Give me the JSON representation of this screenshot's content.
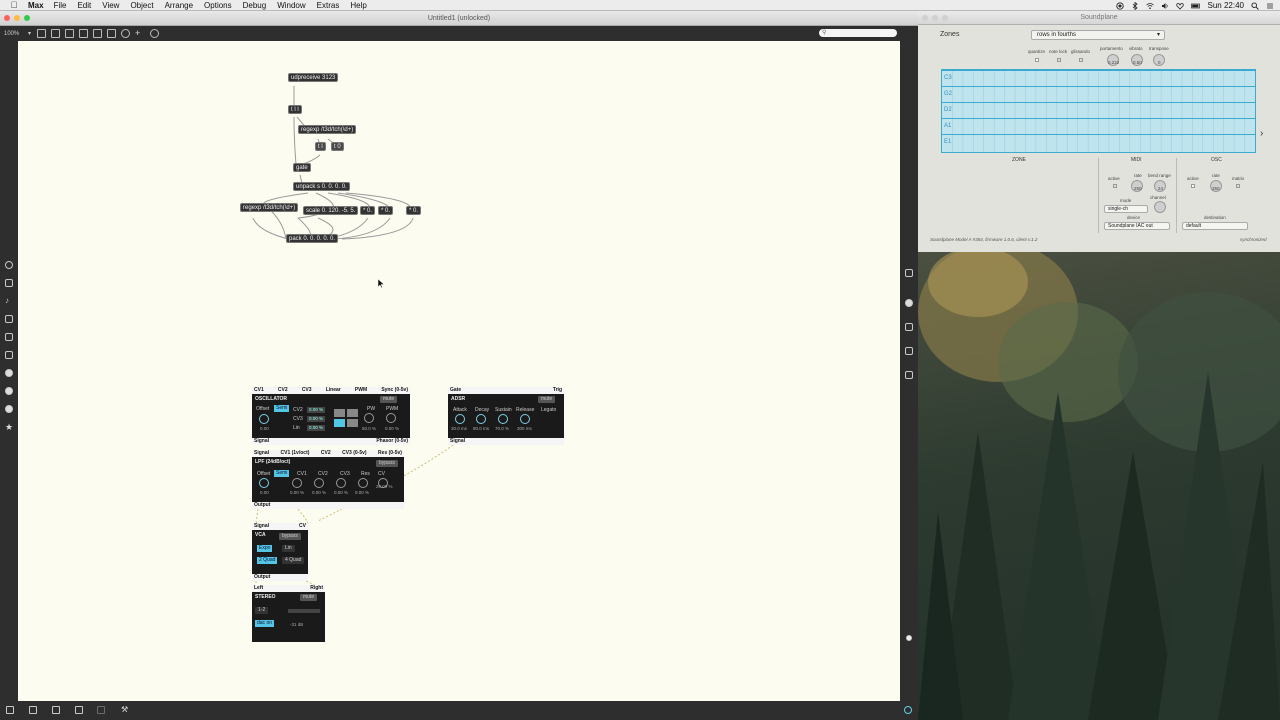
{
  "menubar": {
    "app_name": "Max",
    "items": [
      "File",
      "Edit",
      "View",
      "Object",
      "Arrange",
      "Options",
      "Debug",
      "Window",
      "Extras",
      "Help"
    ],
    "clock": "Sun 22:40"
  },
  "max_window": {
    "title": "Untitled1 (unlocked)",
    "zoom": "100%"
  },
  "patch": {
    "objects": [
      "udpreceive 3123",
      "t l l",
      "regexp /t3d/tch(\\d+)",
      "t l",
      "t 0",
      "gate",
      "unpack s 0. 0. 0. 0.",
      "regexp /t3d/tch(\\d+)",
      "scale 0. 120. -5. 5.",
      "* 0.",
      "* 0.",
      "* 0.",
      "pack 0. 0. 0. 0. 0."
    ]
  },
  "osc_module": {
    "inputs": [
      "CV1",
      "CV2",
      "CV3",
      "Linear",
      "PWM",
      "Sync (0-5v)"
    ],
    "title": "OSCILLATOR",
    "mute": "mute",
    "offset": "Offset",
    "semi": "Semi",
    "cv_labels": [
      "CV2",
      "CV3",
      "Lin"
    ],
    "cv_values": [
      "0.00 %",
      "0.00 %",
      "0.00 %"
    ],
    "pw": "PW",
    "pwm": "PWM",
    "pw_val": "50.0 %",
    "pwm_val": "0.00 %",
    "offset_val": "0.00",
    "outputs": [
      "Signal",
      "Phasor (0-5v)"
    ]
  },
  "adsr_module": {
    "inputs": [
      "Gate",
      "Trig"
    ],
    "title": "ADSR",
    "mute": "mute",
    "labels": [
      "Attack",
      "Decay",
      "Sustain",
      "Release",
      "Legato"
    ],
    "values": [
      "30.0 ms",
      "80.0 ms",
      "70.0 %",
      "300 ms"
    ],
    "outputs": [
      "Signal"
    ]
  },
  "lpf_module": {
    "inputs": [
      "Signal",
      "CV1 (1v/oct)",
      "CV2",
      "CV3 (0-5v)",
      "Res (0-5v)"
    ],
    "title": "LPF (24dB/oct)",
    "bypass": "bypass",
    "labels": [
      "Offset",
      "Semi",
      "CV1",
      "CV2",
      "CV3",
      "Res",
      "CV"
    ],
    "values": [
      "0.00",
      "0.00 %",
      "0.00 %",
      "0.00 %",
      "0.00 %",
      "20.00 %"
    ],
    "outputs": [
      "Output"
    ]
  },
  "vca_module": {
    "inputs": [
      "Signal",
      "CV"
    ],
    "title": "VCA",
    "bypass": "bypass",
    "buttons": [
      "Expo",
      "Lin",
      "2 Quad",
      "4 Quad"
    ],
    "outputs": [
      "Output"
    ]
  },
  "stereo_module": {
    "inputs": [
      "Left",
      "Right"
    ],
    "title": "STEREO",
    "mute": "mute",
    "channels": "1-2",
    "dac": "dac on",
    "level": "-31 dB"
  },
  "soundplane": {
    "title": "Soundplane",
    "zones_label": "Zones",
    "zone_select": "rows in fourths",
    "toggles": [
      "quantize",
      "note lock",
      "glissando"
    ],
    "knobs": [
      "portamento",
      "vibrato",
      "transpose"
    ],
    "knob_values": [
      "0.222",
      "0.50",
      "0"
    ],
    "rows": [
      "C3",
      "G2",
      "D2",
      "A1",
      "E1"
    ],
    "sections": [
      "ZONE",
      "MIDI",
      "OSC"
    ],
    "midi": {
      "active": "active",
      "rate": "rate",
      "rate_val": "250",
      "bend_range": "bend range",
      "bend_val": "24",
      "mode": "mode",
      "mode_val": "single-ch",
      "channel": "channel",
      "device": "device",
      "device_val": "Soundplane IAC out"
    },
    "osc": {
      "active": "active",
      "rate": "rate",
      "rate_val": "250",
      "matrix": "matrix",
      "destination": "destination",
      "destination_val": "default"
    },
    "footer_left": "Soundplane Model A #384, firmware 1.0.6, client v.1.2",
    "footer_right": "synchronized"
  },
  "colors": {
    "patcher_bg": "#fdfcf1",
    "accent_cyan": "#53c6e6",
    "grid_blue": "#3aaad0"
  }
}
